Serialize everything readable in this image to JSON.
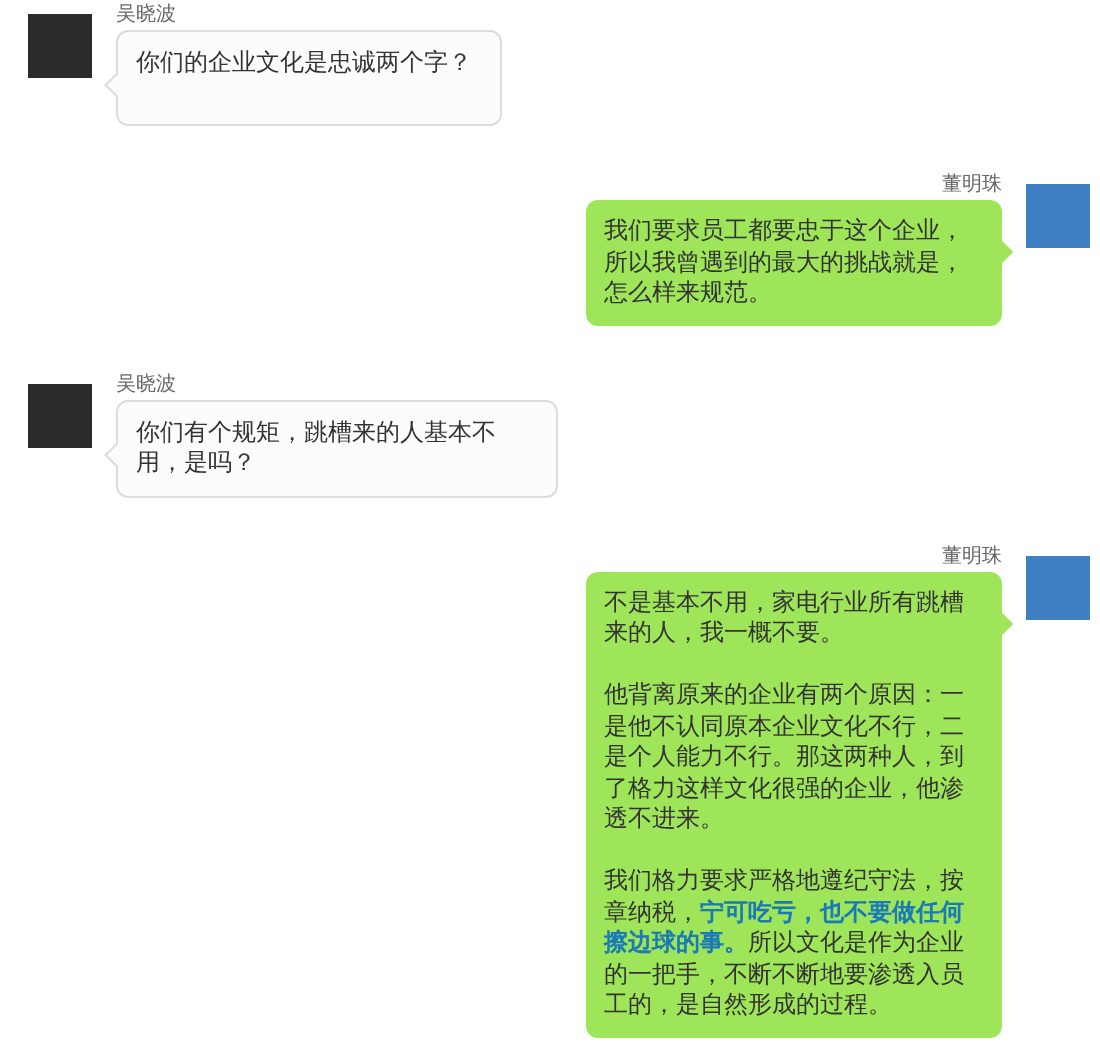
{
  "messages": [
    {
      "kind": "received",
      "sender": "吴晓波",
      "paragraphs": [
        "你们的企业文化是忠诚两个字？"
      ]
    },
    {
      "kind": "sent",
      "sender": "董明珠",
      "paragraphs": [
        "我们要求员工都要忠于这个企业，所以我曾遇到的最大的挑战就是，怎么样来规范。"
      ]
    },
    {
      "kind": "received",
      "sender": "吴晓波",
      "paragraphs": [
        "你们有个规矩，跳槽来的人基本不用，是吗？"
      ]
    },
    {
      "kind": "sent",
      "sender": "董明珠",
      "paragraphs": [
        "不是基本不用，家电行业所有跳槽来的人，我一概不要。",
        "他背离原来的企业有两个原因：一是他不认同原本企业文化不行，二是个人能力不行。那这两种人，到了格力这样文化很强的企业，他渗透不进来。",
        "我们格力要求严格地遵纪守法，按章纳税，**宁可吃亏，也不要做任何擦边球的事。**所以文化是作为企业的一把手，不断不断地要渗透入员工的，是自然形成的过程。"
      ]
    }
  ]
}
